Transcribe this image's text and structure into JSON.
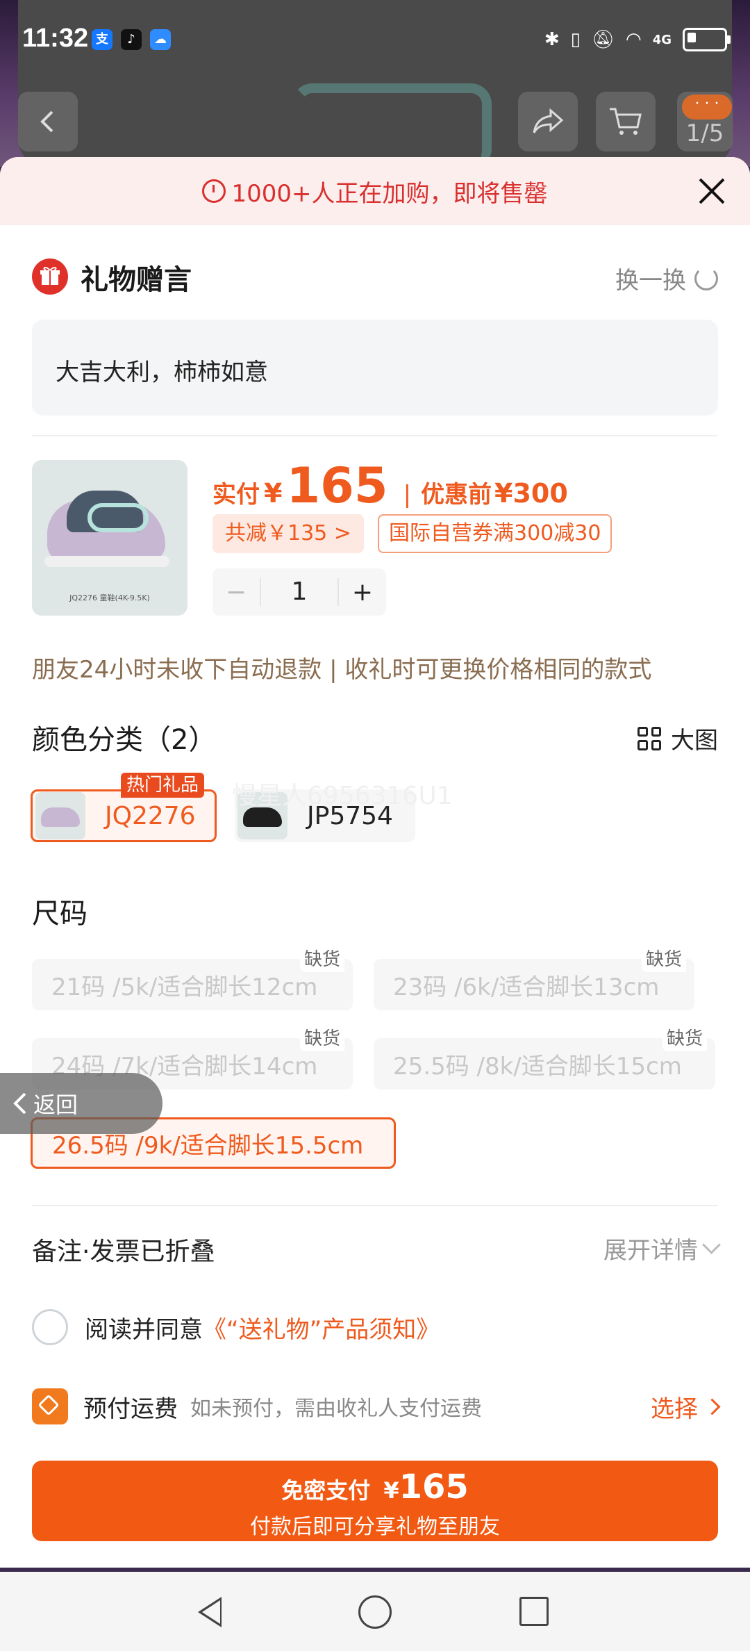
{
  "status_bar": {
    "time": "11:32",
    "app_badges": [
      "alipay-icon",
      "tiktok-icon",
      "weather-icon"
    ],
    "network": "4G"
  },
  "top_nav": {
    "image_counter": "1/5",
    "more_label": "· · ·"
  },
  "alert": {
    "text": "1000+人正在加购，即将售罄"
  },
  "gift": {
    "title": "礼物赠言",
    "swap_label": "换一换",
    "message": "大吉大利，柿柿如意"
  },
  "product": {
    "image_caption": "JQ2276   童鞋(4K-9.5K)",
    "price_label": "实付",
    "currency": "¥",
    "price": "165",
    "separator": "|",
    "original_label": "优惠前",
    "original_price": "¥300",
    "discount_chip": "共减￥135 >",
    "coupon_chip": "国际自营券满300减30",
    "quantity": "1",
    "minus": "−",
    "plus": "+"
  },
  "notice": "朋友24小时未收下自动退款 | 收礼时可更换价格相同的款式",
  "color_section": {
    "title": "颜色分类（2）",
    "big_view_label": "大图",
    "hot_tag": "热门礼品",
    "watermark": "慢星人6956316U1",
    "options": [
      {
        "label": "JQ2276",
        "selected": true,
        "color": "#c8b7d3"
      },
      {
        "label": "JP5754",
        "selected": false,
        "color": "#1f1f1f"
      }
    ]
  },
  "size_section": {
    "title": "尺码",
    "out_of_stock_label": "缺货",
    "options": [
      {
        "label": "21码 /5k/适合脚长12cm",
        "status": "out_of_stock"
      },
      {
        "label": "23码 /6k/适合脚长13cm",
        "status": "out_of_stock"
      },
      {
        "label": "24码 /7k/适合脚长14cm",
        "status": "out_of_stock"
      },
      {
        "label": "25.5码 /8k/适合脚长15cm",
        "status": "out_of_stock"
      },
      {
        "label": "26.5码 /9k/适合脚长15.5cm",
        "status": "selected"
      }
    ]
  },
  "back_float": {
    "label": "返回"
  },
  "remark": {
    "label": "备注·发票已折叠",
    "expand_label": "展开详情"
  },
  "agreement": {
    "prefix": "阅读并同意",
    "link": "《“送礼物”产品须知》"
  },
  "shipping": {
    "title": "预付运费",
    "desc": "如未预付，需由收礼人支付运费",
    "select_label": "选择"
  },
  "pay_button": {
    "label": "免密支付",
    "currency": "¥",
    "amount": "165",
    "subtitle": "付款后即可分享礼物至朋友"
  },
  "colors": {
    "accent": "#ef5a1e",
    "alert_red": "#d9302e",
    "pay_orange": "#f25a13"
  }
}
